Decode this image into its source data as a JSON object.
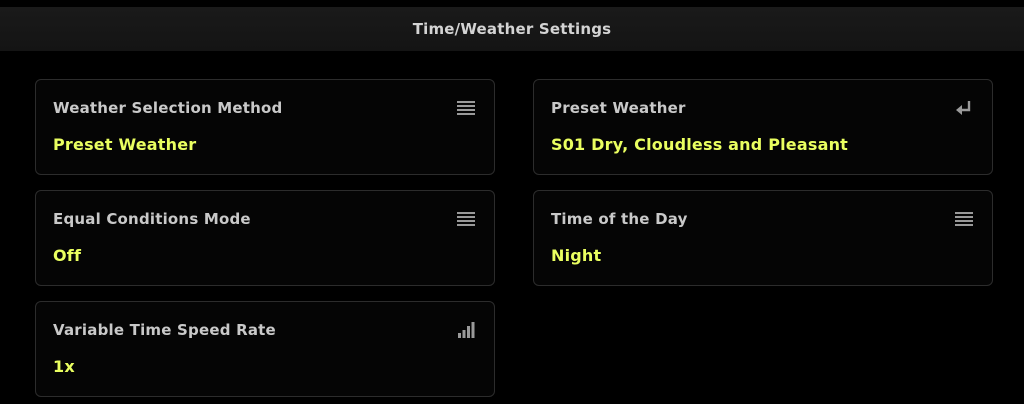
{
  "header": {
    "title": "Time/Weather Settings"
  },
  "settings": [
    {
      "label": "Weather Selection Method",
      "value": "Preset Weather",
      "icon": "list-icon"
    },
    {
      "label": "Preset Weather",
      "value": "S01 Dry, Cloudless and Pleasant",
      "icon": "enter-icon"
    },
    {
      "label": "Equal Conditions Mode",
      "value": "Off",
      "icon": "list-icon"
    },
    {
      "label": "Time of the Day",
      "value": "Night",
      "icon": "list-icon"
    },
    {
      "label": "Variable Time Speed Rate",
      "value": "1x",
      "icon": "signal-bars-icon"
    }
  ],
  "colors": {
    "value_accent": "#eaff60",
    "label": "#c9c9c9",
    "card_border": "#2c2c2c",
    "background": "#000000"
  }
}
